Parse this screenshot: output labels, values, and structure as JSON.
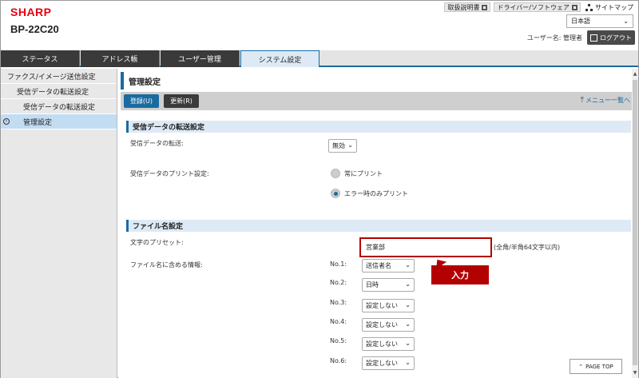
{
  "brand": {
    "logo": "SHARP",
    "model": "BP-22C20",
    "logo_color": "#e60012"
  },
  "header": {
    "links": [
      "取扱説明書",
      "ドライバー/ソフトウェア"
    ],
    "sitemap": "サイトマップ",
    "language": "日本語",
    "user_label": "ユーザー名: 管理者",
    "logout": "ログアウト"
  },
  "tabs": [
    {
      "label": "ステータス",
      "active": false
    },
    {
      "label": "アドレス帳",
      "active": false
    },
    {
      "label": "ユーザー管理",
      "active": false
    },
    {
      "label": "システム設定",
      "active": true
    }
  ],
  "sidebar": {
    "items": [
      {
        "label": "ファクス/イメージ送信設定",
        "level": 0
      },
      {
        "label": "受信データの転送設定",
        "level": 1
      },
      {
        "label": "受信データの転送設定",
        "level": 2
      },
      {
        "label": "管理設定",
        "level": 2,
        "active": true
      }
    ]
  },
  "main": {
    "title": "管理設定",
    "register_button": "登録(U)",
    "update_button": "更新(R)",
    "menu_back": "メニュー一覧へ",
    "section1": {
      "title": "受信データの転送設定",
      "transfer_label": "受信データの転送:",
      "transfer_value": "無効",
      "print_label": "受信データのプリント設定:",
      "radio_always": "常にプリント",
      "radio_error": "エラー時のみプリント"
    },
    "section2": {
      "title": "ファイル名設定",
      "preset_label": "文字のプリセット:",
      "preset_value": "営業部",
      "preset_hint": "(全角/半角64文字以内)",
      "include_label": "ファイル名に含める情報:",
      "callout": "入力",
      "rows": [
        {
          "no": "No.1:",
          "value": "送信者名"
        },
        {
          "no": "No.2:",
          "value": "日時"
        },
        {
          "no": "No.3:",
          "value": "設定しない"
        },
        {
          "no": "No.4:",
          "value": "設定しない"
        },
        {
          "no": "No.5:",
          "value": "設定しない"
        },
        {
          "no": "No.6:",
          "value": "設定しない"
        }
      ]
    },
    "page_top": "PAGE TOP"
  },
  "colors": {
    "accent": "#1a6ba0",
    "highlight": "#b30000",
    "tab_dark": "#3a3a3a"
  }
}
